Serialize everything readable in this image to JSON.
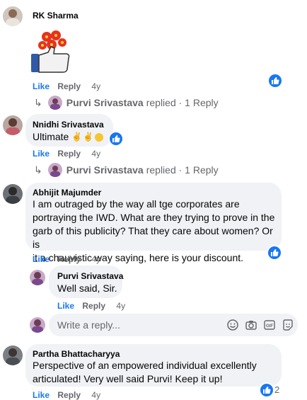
{
  "comments": [
    {
      "author": "RK Sharma",
      "text": "",
      "like": "Like",
      "reply": "Reply",
      "time": "4y"
    },
    {
      "author": "Nnidhi Srivastava",
      "text": "Ultimate",
      "like": "Like",
      "reply": "Reply",
      "time": "4y"
    },
    {
      "author": "Abhijit Majumder",
      "lines": [
        "I am outraged by the way all tge corporates are",
        "portraying the IWD. What are they trying to prove in the",
        "garb of this publicity? That they care about women? Or is",
        "it a chauvistic way saying, here is your discount."
      ],
      "like": "Like",
      "reply": "Reply",
      "time": "4y"
    },
    {
      "author": "Purvi Srivastava",
      "text": "Well said, Sir.",
      "like": "Like",
      "reply": "Reply",
      "time": "4y"
    },
    {
      "author": "Partha Bhattacharyya",
      "lines": [
        "Perspective of an empowered individual excellently",
        "articulated! Very well said Purvi! Keep it up!"
      ],
      "like": "Like",
      "reply": "Reply",
      "time": "4y",
      "reaction_count": "2"
    }
  ],
  "replied_rows": [
    {
      "name": "Purvi Srivastava",
      "suffix": "replied · 1 Reply"
    },
    {
      "name": "Purvi Srivastava",
      "suffix": "replied · 1 Reply"
    }
  ],
  "reply_box": {
    "placeholder": "Write a reply..."
  },
  "icons": {
    "like": "thumbs-up-icon",
    "sticker": "thumbs-up-flowers-sticker",
    "emoji": "emoji-icon",
    "camera": "camera-icon",
    "gif": "gif-icon",
    "sticker_button": "sticker-icon"
  },
  "colors": {
    "accent": "#1877f2",
    "bubble": "#f0f2f5",
    "meta": "#65676b"
  }
}
